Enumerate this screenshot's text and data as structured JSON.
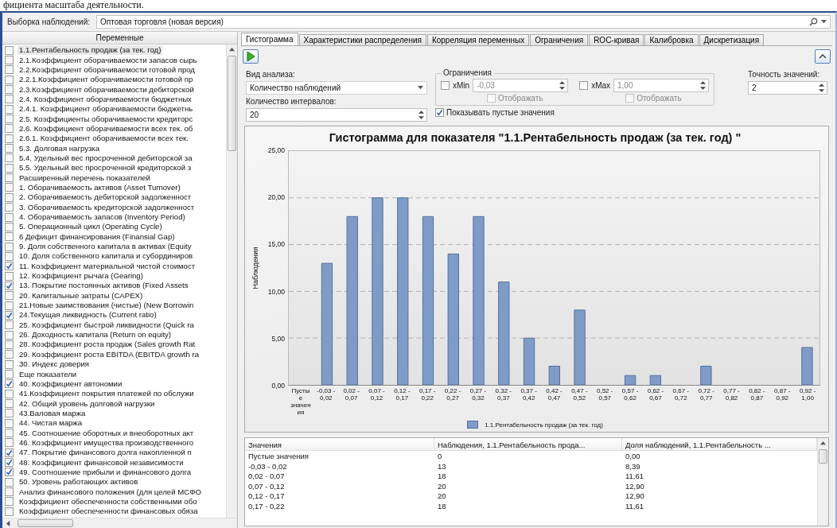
{
  "page_caption": "фициента масштаба деятельности.",
  "sample": {
    "label": "Выборка наблюдений:",
    "value": "Оптовая торговля (новая версия)"
  },
  "variables": {
    "header": "Переменные",
    "items": [
      {
        "label": "1.1.Рентабельность продаж (за тек. год)",
        "checked": false,
        "selected": true
      },
      {
        "label": "2.1.Коэффициент оборачиваемости запасов сырь",
        "checked": false,
        "selected": false
      },
      {
        "label": "2.2.Коэффициент оборачиваемости готовой прод",
        "checked": false,
        "selected": false
      },
      {
        "label": "2.2.1.Коэффициент оборачиваемости готовой пр",
        "checked": false,
        "selected": false
      },
      {
        "label": "2.3.Коэффициент оборачиваемости дебиторской",
        "checked": false,
        "selected": false
      },
      {
        "label": "2.4. Коэффициент оборачиваемости бюджетных",
        "checked": false,
        "selected": false
      },
      {
        "label": "2.4.1. Коэффициент оборачиваемости бюджетнь",
        "checked": false,
        "selected": false
      },
      {
        "label": "2.5. Коэффициенты оборачиваемости кредиторс",
        "checked": false,
        "selected": false
      },
      {
        "label": "2.6. Коэффициент оборачиваемости всех тек. об",
        "checked": false,
        "selected": false
      },
      {
        "label": "2.6.1. Коэффициент оборачиваемости всех тек.",
        "checked": false,
        "selected": false
      },
      {
        "label": "5.3. Долговая нагрузка",
        "checked": false,
        "selected": false
      },
      {
        "label": "5.4. Удельный вес просроченной дебиторской за",
        "checked": false,
        "selected": false
      },
      {
        "label": "5.5. Удельный вес просроченной кредиторской з",
        "checked": false,
        "selected": false
      },
      {
        "label": "Расширенный перечень показателей",
        "checked": false,
        "selected": false
      },
      {
        "label": "1. Оборачиваемость активов (Asset Turnover)",
        "checked": false,
        "selected": false
      },
      {
        "label": "2. Оборачиваемость дебиторской задолженност",
        "checked": false,
        "selected": false
      },
      {
        "label": "3. Оборачиваемость кредиторской задолженност",
        "checked": false,
        "selected": false
      },
      {
        "label": "4. Оборачиваемость запасов (Inventory Period)",
        "checked": false,
        "selected": false
      },
      {
        "label": "5. Операционный цикл (Operating Cycle)",
        "checked": false,
        "selected": false
      },
      {
        "label": "6 Дефицит финансирования (Finansial Gap)",
        "checked": false,
        "selected": false
      },
      {
        "label": "9. Доля собственного капитала в активах (Equity",
        "checked": false,
        "selected": false
      },
      {
        "label": "10. Доля собственного капитала и субординиров",
        "checked": false,
        "selected": false
      },
      {
        "label": "11. Коэффициент материальной чистой стоимост",
        "checked": true,
        "selected": false
      },
      {
        "label": "12. Коэффициент рычага (Gearing)",
        "checked": false,
        "selected": false
      },
      {
        "label": "13. Покрытие постоянных активов (Fixed Assets",
        "checked": true,
        "selected": false
      },
      {
        "label": "20. Капитальные затраты (CAPEX)",
        "checked": false,
        "selected": false
      },
      {
        "label": "21.Новые заимствования (чистые) (New Borrowin",
        "checked": false,
        "selected": false
      },
      {
        "label": "24.Текущая ликвидность (Current ratio)",
        "checked": true,
        "selected": false
      },
      {
        "label": "25. Коэффициент быстрой ликвидности (Quick ra",
        "checked": false,
        "selected": false
      },
      {
        "label": "26. Доходность капитала (Return on equity)",
        "checked": false,
        "selected": false
      },
      {
        "label": "28. Коэффициент роста продаж (Sales growth Rat",
        "checked": false,
        "selected": false
      },
      {
        "label": "29. Коэффициент роста EBITDA (EBITDA growth ra",
        "checked": false,
        "selected": false
      },
      {
        "label": "30. Индекс доверия",
        "checked": false,
        "selected": false
      },
      {
        "label": "Еще показатели",
        "checked": false,
        "selected": false
      },
      {
        "label": "40. Коэффициент автономии",
        "checked": true,
        "selected": false
      },
      {
        "label": "41.Коэффициент покрытия платежей по обслужи",
        "checked": false,
        "selected": false
      },
      {
        "label": "42. Общий уровень долговой нагрузки",
        "checked": false,
        "selected": false
      },
      {
        "label": "43.Валовая маржа",
        "checked": false,
        "selected": false
      },
      {
        "label": "44. Чистая маржа",
        "checked": false,
        "selected": false
      },
      {
        "label": "45. Соотношение оборотных и внеоборотных акт",
        "checked": false,
        "selected": false
      },
      {
        "label": "46. Коэффициент имущества производственного",
        "checked": false,
        "selected": false
      },
      {
        "label": "47. Покрытие финансового долга накопленной п",
        "checked": true,
        "selected": false
      },
      {
        "label": "48. Коэффициент финансовой независимости",
        "checked": true,
        "selected": false
      },
      {
        "label": "49. Соотношение прибыли и финансового долга",
        "checked": true,
        "selected": false
      },
      {
        "label": "50. Уровень работающих активов",
        "checked": false,
        "selected": false
      },
      {
        "label": "Анализ финансового положения (для целей МСФО",
        "checked": false,
        "selected": false
      },
      {
        "label": "Коэффициент обеспеченности собственными обо",
        "checked": false,
        "selected": false
      },
      {
        "label": "Коэффициент обеспеченности финансовых обяза",
        "checked": false,
        "selected": false
      }
    ]
  },
  "tabs": [
    {
      "label": "Гистограмма",
      "selected": true
    },
    {
      "label": "Характеристики распределения",
      "selected": false
    },
    {
      "label": "Корреляция переменных",
      "selected": false
    },
    {
      "label": "Ограничения",
      "selected": false
    },
    {
      "label": "ROC-кривая",
      "selected": false
    },
    {
      "label": "Калибровка",
      "selected": false
    },
    {
      "label": "Дискретизация",
      "selected": false
    }
  ],
  "analysis_type": {
    "label": "Вид анализа:",
    "value": "Количество наблюдений"
  },
  "interval_count": {
    "label": "Количество интервалов:",
    "value": "20"
  },
  "limits": {
    "title": "Ограничения",
    "bounds": [
      {
        "label": "xMin",
        "checked": false,
        "value": "-0,03",
        "show_label": "Отображать",
        "show_checked": false
      },
      {
        "label": "xMax",
        "checked": false,
        "value": "1,00",
        "show_label": "Отображать",
        "show_checked": false
      }
    ]
  },
  "show_empty": {
    "label": "Показывать пустые значения",
    "checked": true
  },
  "precision": {
    "label": "Точность значений:",
    "value": "2"
  },
  "chart": {
    "chart_data": {
      "type": "bar",
      "title": "Гистограмма для показателя \"1.1.Рентабельность продаж (за тек. год) \"",
      "ylabel": "Наблюдения",
      "categories": [
        "Пустые значения",
        "-0,03 - 0,02",
        "0,02 - 0,07",
        "0,07 - 0,12",
        "0,12 - 0,17",
        "0,17 - 0,22",
        "0,22 - 0,27",
        "0,27 - 0,32",
        "0,32 - 0,37",
        "0,37 - 0,42",
        "0,42 - 0,47",
        "0,47 - 0,52",
        "0,52 - 0,57",
        "0,57 - 0,62",
        "0,62 - 0,67",
        "0,67 - 0,72",
        "0,72 - 0,77",
        "0,77 - 0,82",
        "0,82 - 0,87",
        "0,87 - 0,92",
        "0,92 - 1,00"
      ],
      "series": [
        {
          "name": "1.1.Рентабельность продаж (за тек. год)",
          "color": "#7f9cc8",
          "values": [
            0,
            13,
            18,
            20,
            20,
            18,
            14,
            18,
            11,
            5,
            2,
            8,
            0,
            1,
            1,
            0,
            2,
            0,
            0,
            0,
            4
          ]
        }
      ],
      "ylim": [
        0,
        25
      ],
      "grid": true,
      "yticks": [
        {
          "value": 0,
          "label": "0,00"
        },
        {
          "value": 5,
          "label": "5,00"
        },
        {
          "value": 10,
          "label": "10,00"
        },
        {
          "value": 15,
          "label": "15,00"
        },
        {
          "value": 20,
          "label": "20,00"
        },
        {
          "value": 25,
          "label": "25,00"
        }
      ]
    }
  },
  "table": {
    "columns": [
      "Значения",
      "Наблюдения, 1.1.Рентабельность прода...",
      "Доля наблюдений, 1.1.Рентабельность ..."
    ],
    "rows": [
      [
        "Пустые значения",
        "0",
        "0,00"
      ],
      [
        "-0,03 - 0,02",
        "13",
        "8,39"
      ],
      [
        "0,02 - 0,07",
        "18",
        "11,61"
      ],
      [
        "0,07 - 0,12",
        "20",
        "12,90"
      ],
      [
        "0,12 - 0,17",
        "20",
        "12,90"
      ],
      [
        "0,17 - 0,22",
        "18",
        "11,61"
      ]
    ]
  }
}
